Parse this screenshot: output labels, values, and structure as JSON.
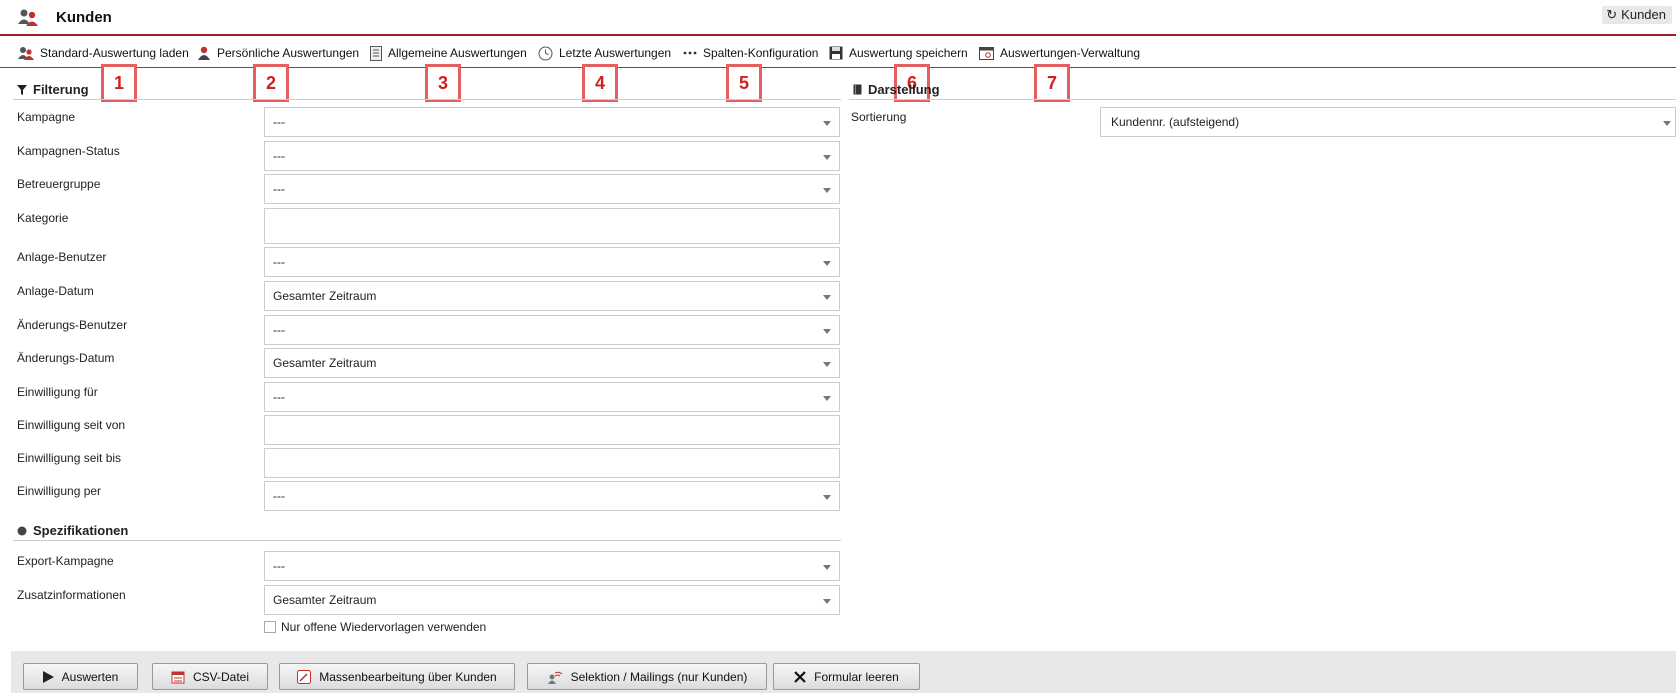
{
  "header": {
    "title": "Kunden",
    "refresh_label": "Kunden"
  },
  "toolbar": {
    "items": [
      {
        "label": "Standard-Auswertung laden",
        "icon": "users-icon"
      },
      {
        "label": "Persönliche Auswertungen",
        "icon": "user-icon"
      },
      {
        "label": "Allgemeine Auswertungen",
        "icon": "document-list-icon"
      },
      {
        "label": "Letzte Auswertungen",
        "icon": "clock-icon"
      },
      {
        "label": "Spalten-Konfiguration",
        "icon": "dots-icon"
      },
      {
        "label": "Auswertung speichern",
        "icon": "floppy-disk-icon"
      },
      {
        "label": "Auswertungen-Verwaltung",
        "icon": "window-settings-icon"
      }
    ]
  },
  "badges": [
    "1",
    "2",
    "3",
    "4",
    "5",
    "6",
    "7"
  ],
  "filterung": {
    "title": "Filterung",
    "rows": [
      {
        "label": "Kampagne",
        "value": "---",
        "type": "select"
      },
      {
        "label": "Kampagnen-Status",
        "value": "---",
        "type": "select"
      },
      {
        "label": "Betreuergruppe",
        "value": "---",
        "type": "select"
      },
      {
        "label": "Kategorie",
        "value": "",
        "type": "text"
      },
      {
        "label": "Anlage-Benutzer",
        "value": "---",
        "type": "select"
      },
      {
        "label": "Anlage-Datum",
        "value": "Gesamter Zeitraum",
        "type": "select"
      },
      {
        "label": "Änderungs-Benutzer",
        "value": "---",
        "type": "select"
      },
      {
        "label": "Änderungs-Datum",
        "value": "Gesamter Zeitraum",
        "type": "select"
      },
      {
        "label": "Einwilligung für",
        "value": "---",
        "type": "select"
      },
      {
        "label": "Einwilligung seit von",
        "value": "",
        "type": "text"
      },
      {
        "label": "Einwilligung seit bis",
        "value": "",
        "type": "text"
      },
      {
        "label": "Einwilligung per",
        "value": "---",
        "type": "select"
      }
    ]
  },
  "spezifikationen": {
    "title": "Spezifikationen",
    "rows": [
      {
        "label": "Export-Kampagne",
        "value": "---",
        "type": "select"
      },
      {
        "label": "Zusatzinformationen",
        "value": "Gesamter Zeitraum",
        "type": "select"
      }
    ],
    "checkbox_label": "Nur offene Wiedervorlagen verwenden"
  },
  "darstellung": {
    "title": "Darstellung",
    "sort_label": "Sortierung",
    "sort_value": "Kundennr. (aufsteigend)"
  },
  "footer": {
    "buttons": [
      {
        "label": "Auswerten",
        "icon": "play-icon"
      },
      {
        "label": "CSV-Datei",
        "icon": "csv-file-icon"
      },
      {
        "label": "Massenbearbeitung über Kunden",
        "icon": "edit-icon"
      },
      {
        "label": "Selektion / Mailings (nur Kunden)",
        "icon": "mailing-icon"
      },
      {
        "label": "Formular leeren",
        "icon": "close-icon"
      }
    ]
  },
  "colors": {
    "accent": "#a02020",
    "badge_border": "#e36060",
    "badge_text": "#d02020"
  }
}
